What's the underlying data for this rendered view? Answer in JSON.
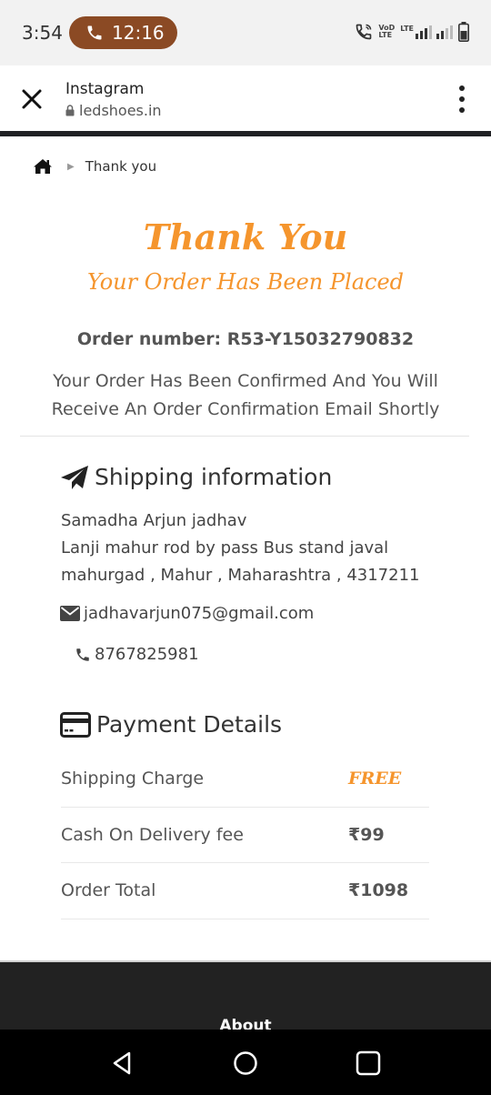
{
  "status_bar": {
    "time": "3:54",
    "call_timer": "12:16",
    "vol_label_1": "VoD",
    "vol_label_2": "LTE",
    "lte_label": "LTE"
  },
  "browser": {
    "title": "Instagram",
    "url": "ledshoes.in"
  },
  "breadcrumb": {
    "current": "Thank you"
  },
  "thankyou": {
    "title": "Thank You",
    "subtitle": "Your Order Has Been Placed",
    "order_number": "Order number: R53-Y15032790832",
    "message": "Your Order Has Been Confirmed And You Will Receive An Order Confirmation Email Shortly"
  },
  "shipping": {
    "heading": "Shipping information",
    "name": "Samadha Arjun jadhav",
    "address_line1": "Lanji mahur rod by pass Bus stand javal",
    "address_line2": "mahurgad , Mahur , Maharashtra , 4317211",
    "email": "jadhavarjun075@gmail.com",
    "phone": "8767825981"
  },
  "payment": {
    "heading": "Payment Details",
    "rows": [
      {
        "label": "Shipping Charge",
        "value": "FREE"
      },
      {
        "label": "Cash On Delivery fee",
        "value": "₹99"
      },
      {
        "label": "Order Total",
        "value": "₹1098"
      }
    ]
  },
  "footer": {
    "about": "About"
  },
  "colors": {
    "accent": "#f5952d",
    "call_pill": "#8b4a24",
    "footer_bg": "#222222"
  },
  "icons": {
    "phone_call": "phone-icon",
    "close": "close-icon",
    "lock": "lock-icon",
    "menu": "more-vert-icon",
    "home": "home-icon",
    "plane": "paper-plane-icon",
    "envelope": "envelope-icon",
    "card": "credit-card-icon",
    "back": "nav-back-icon",
    "home_nav": "nav-home-icon",
    "recents": "nav-recents-icon"
  }
}
